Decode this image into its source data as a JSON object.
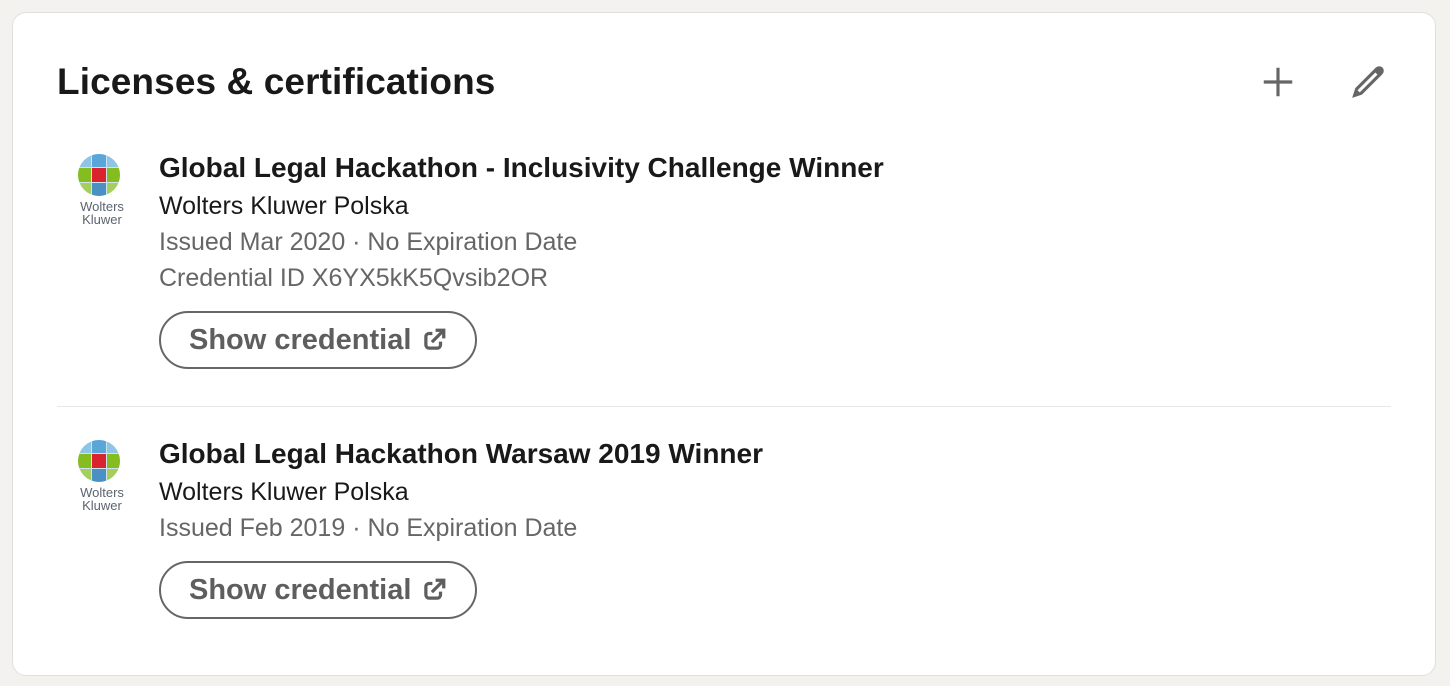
{
  "section": {
    "title": "Licenses & certifications",
    "add_icon": "plus-icon",
    "edit_icon": "pencil-icon"
  },
  "certifications": [
    {
      "title": "Global Legal Hackathon - Inclusivity Challenge Winner",
      "issuer": "Wolters Kluwer Polska",
      "issued": "Issued Mar 2020 · No Expiration Date",
      "credential_id": "Credential ID X6YX5kK5Qvsib2OR",
      "button_label": "Show credential",
      "logo_text_line1": "Wolters",
      "logo_text_line2": "Kluwer"
    },
    {
      "title": "Global Legal Hackathon Warsaw 2019 Winner",
      "issuer": "Wolters Kluwer Polska",
      "issued": "Issued Feb 2019 · No Expiration Date",
      "button_label": "Show credential",
      "logo_text_line1": "Wolters",
      "logo_text_line2": "Kluwer"
    }
  ],
  "colors": {
    "page_bg": "#f3f2ef",
    "card_bg": "#ffffff",
    "secondary_text": "#666666",
    "logo_red": "#d9232e",
    "logo_green": "#85bc20",
    "logo_blue": "#4a90c2"
  }
}
